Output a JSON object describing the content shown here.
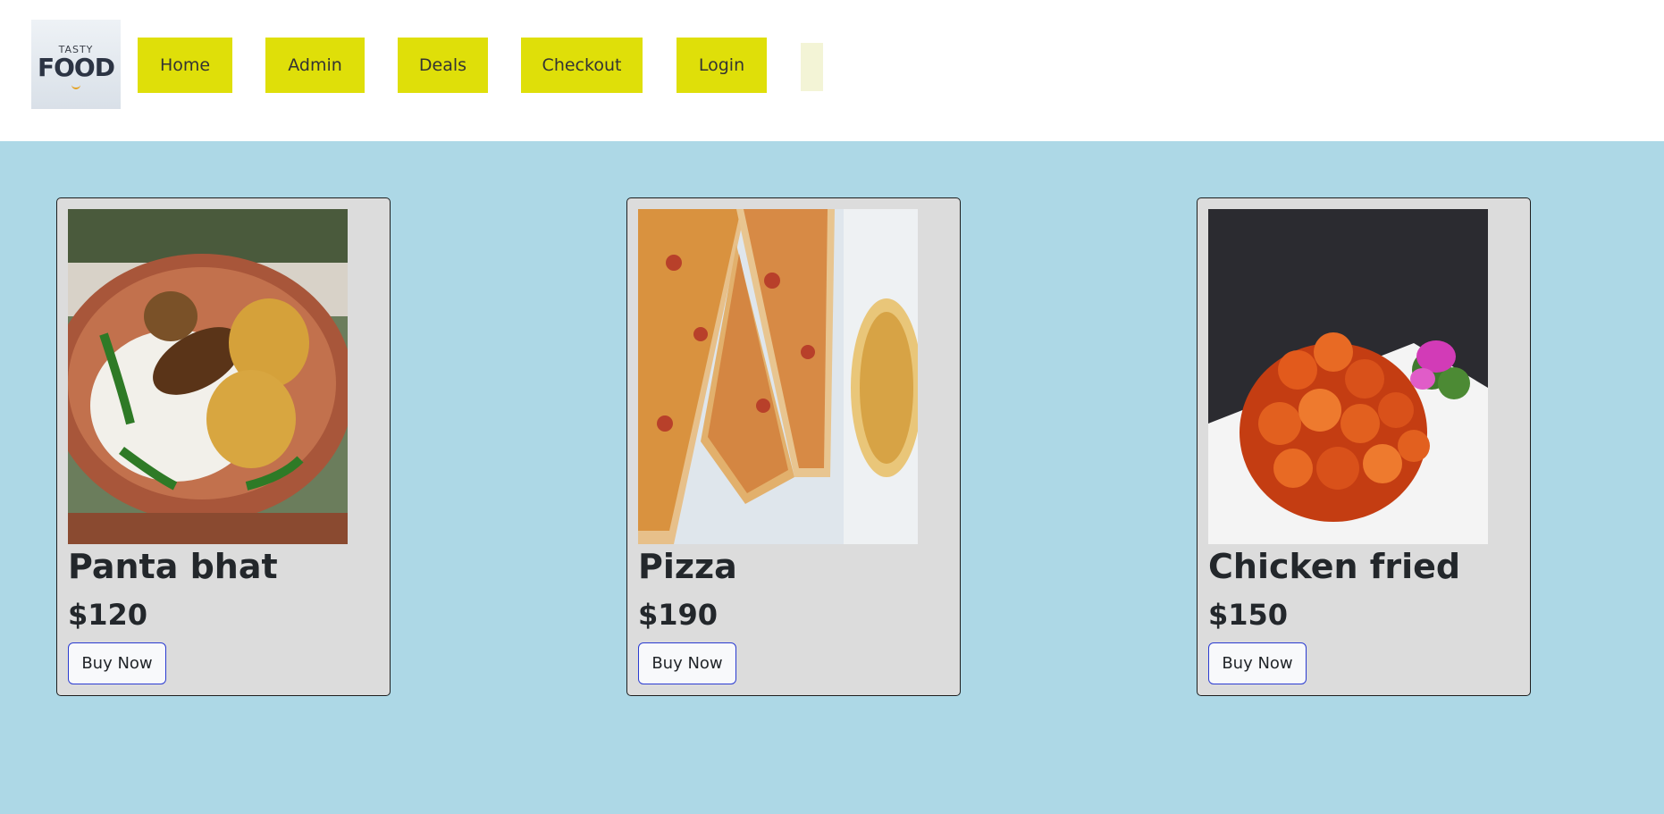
{
  "logo": {
    "top_text": "TASTY",
    "main_text": "FOOD"
  },
  "nav": {
    "items": [
      {
        "label": "Home"
      },
      {
        "label": "Admin"
      },
      {
        "label": "Deals"
      },
      {
        "label": "Checkout"
      },
      {
        "label": "Login"
      }
    ]
  },
  "colors": {
    "page_background": "#add8e6",
    "header_background": "#ffffff",
    "nav_button": "#dfdf09",
    "card_background": "#dcdcdc",
    "buy_button_border": "#2a3bd1"
  },
  "products": [
    {
      "name": "Panta bhat",
      "price": "$120",
      "button_label": "Buy Now",
      "image": "panta-bhat-photo"
    },
    {
      "name": "Pizza",
      "price": "$190",
      "button_label": "Buy Now",
      "image": "pizza-photo"
    },
    {
      "name": "Chicken fried",
      "price": "$150",
      "button_label": "Buy Now",
      "image": "chicken-fried-photo"
    }
  ]
}
